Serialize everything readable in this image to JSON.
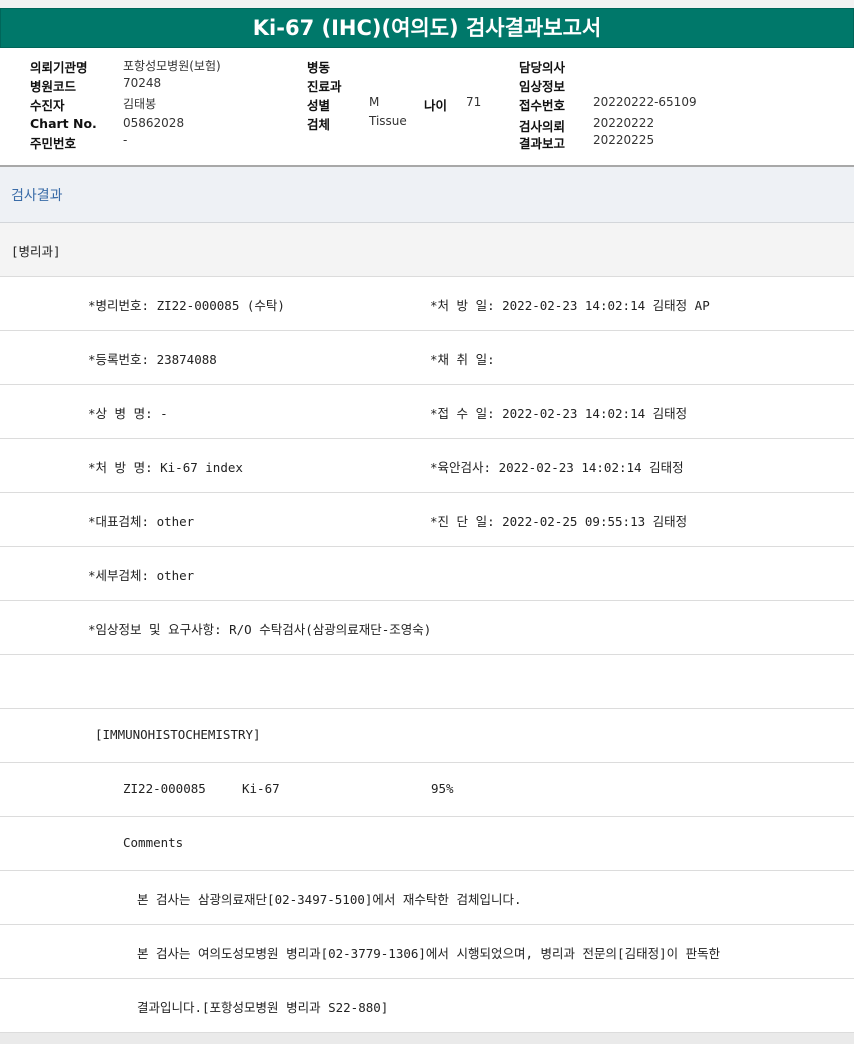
{
  "title": "Ki-67 (IHC)(여의도) 검사결과보고서",
  "header_fields": {
    "institution_label": "의뢰기관명",
    "institution_value": "포항성모병원(보험)",
    "hospital_code_label": "병원코드",
    "hospital_code_value": "70248",
    "patient_label": "수진자",
    "patient_value": "김태봉",
    "chart_label": "Chart No.",
    "chart_value": "05862028",
    "resident_label": "주민번호",
    "resident_value": "-",
    "ward_label": "병동",
    "ward_value": "",
    "department_label": "진료과",
    "department_value": "",
    "sex_label": "성별",
    "sex_value": "M",
    "age_label": "나이",
    "age_value": "71",
    "specimen_label": "검체",
    "specimen_value": "Tissue",
    "doctor_label": "담당의사",
    "doctor_value": "",
    "clinical_label": "임상정보",
    "clinical_value": "",
    "receipt_label": "접수번호",
    "receipt_value": "20220222-65109",
    "request_label": "검사의뢰",
    "request_value": "20220222",
    "report_label": "결과보고",
    "report_value": "20220225"
  },
  "section_title": "검사결과",
  "department_tag": "[병리과]",
  "details": {
    "pathology_no": "*병리번호: ZI22-000085 (수탁)",
    "prescription_date": "*처 방 일: 2022-02-23 14:02:14  김태정 AP",
    "registration_no": "*등록번호: 23874088",
    "collection_date": "*채 취 일:",
    "disease_name": "*상 병 명: -",
    "receipt_date": "*접 수 일: 2022-02-23 14:02:14  김태정",
    "prescription_name": "*처 방 명: Ki-67 index",
    "gross_exam": "*육안검사: 2022-02-23 14:02:14  김태정",
    "main_specimen": "*대표검체: other",
    "diagnosis_date": "*진 단 일: 2022-02-25 09:55:13  김태정",
    "sub_specimen": "*세부검체: other",
    "clinical_request": "*임상정보 및 요구사항: R/O 수탁검사(삼광의료재단-조영숙)"
  },
  "ihc": {
    "heading": "[IMMUNOHISTOCHEMISTRY]",
    "case_no": "ZI22-000085",
    "marker": "Ki-67",
    "result": "95%",
    "comments_label": "Comments",
    "comment_1": "본 검사는 삼광의료재단[02-3497-5100]에서 재수탁한 검체입니다.",
    "comment_2": "본 검사는 여의도성모병원 병리과[02-3779-1306]에서 시행되었으며, 병리과 전문의[김태정]이 판독한",
    "comment_3": "결과입니다.[포항성모병원 병리과 S22-880]"
  }
}
